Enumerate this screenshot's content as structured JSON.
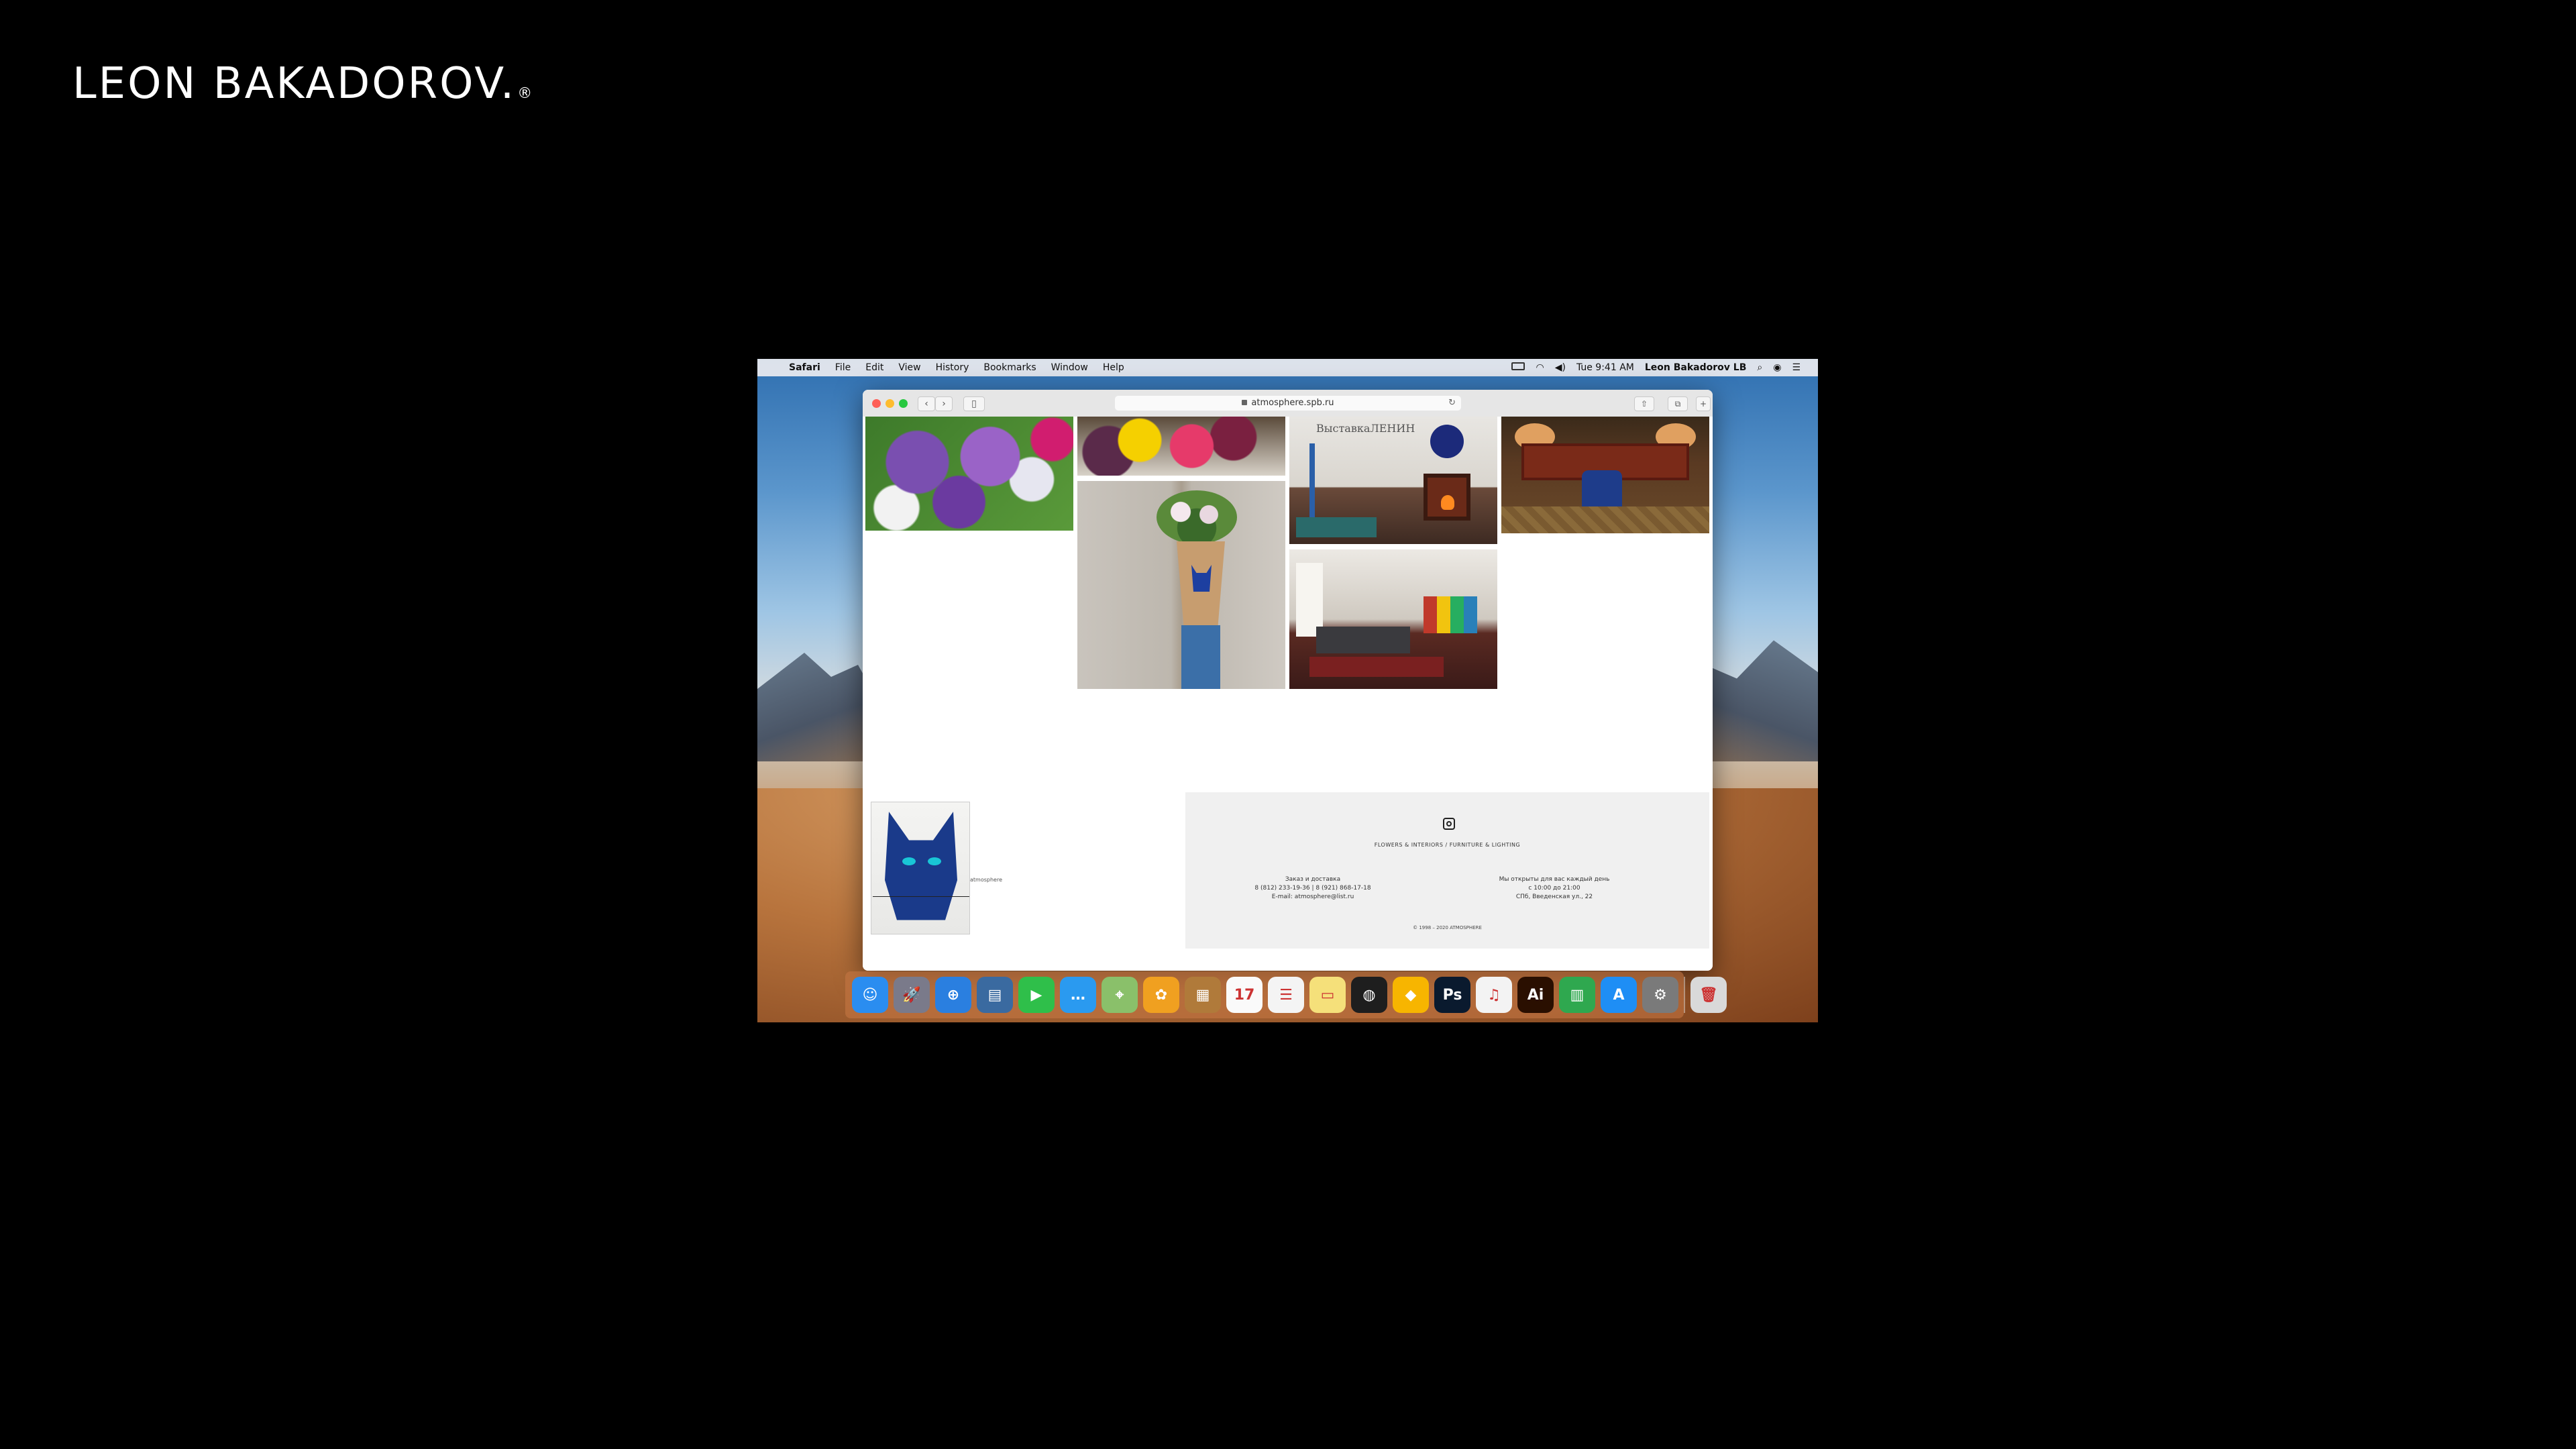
{
  "brand": {
    "name": "LEON BAKADOROV.",
    "mark": "®"
  },
  "menubar": {
    "app": "Safari",
    "items": [
      "File",
      "Edit",
      "View",
      "History",
      "Bookmarks",
      "Window",
      "Help"
    ],
    "clock": "Tue 9:41 AM",
    "user": "Leon Bakadorov LB"
  },
  "browser": {
    "url": "atmosphere.spb.ru",
    "nav_back": "‹",
    "nav_forward": "›"
  },
  "page": {
    "room_text": "ВыставкаЛЕНИН",
    "cat_caption": "atmosphere",
    "footer": {
      "tagline": "FLOWERS & INTERIORS / FURNITURE & LIGHTING",
      "col_left": [
        "Заказ и доставка",
        "8 (812) 233-19-36 | 8 (921) 868-17-18",
        "E-mail: atmosphere@list.ru"
      ],
      "col_right": [
        "Мы открыты для вас каждый день",
        "с 10:00 до 21:00",
        "СПб, Введенская ул., 22"
      ],
      "copyright": "© 1998 – 2020 ATMOSPHERE"
    }
  },
  "dock": {
    "icons": [
      {
        "name": "finder-icon",
        "color": "#2a8df0",
        "glyph": "☺"
      },
      {
        "name": "launchpad-icon",
        "color": "#7a7a8a",
        "glyph": "🚀"
      },
      {
        "name": "safari-icon",
        "color": "#2a7fe0",
        "glyph": "⊕"
      },
      {
        "name": "preview-icon",
        "color": "#3a6aa0",
        "glyph": "▤"
      },
      {
        "name": "facetime-icon",
        "color": "#2fbf4a",
        "glyph": "▶"
      },
      {
        "name": "messages-icon",
        "color": "#2a9af0",
        "glyph": "…"
      },
      {
        "name": "maps-icon",
        "color": "#8ac06a",
        "glyph": "⌖"
      },
      {
        "name": "photos-icon",
        "color": "#f0a020",
        "glyph": "✿"
      },
      {
        "name": "notes-brown-icon",
        "color": "#b07a3a",
        "glyph": "▦"
      },
      {
        "name": "calendar-icon",
        "color": "#fafafa",
        "glyph": "17"
      },
      {
        "name": "reminders-icon",
        "color": "#f4f4f4",
        "glyph": "☰"
      },
      {
        "name": "notes-icon",
        "color": "#f5e07a",
        "glyph": "▭"
      },
      {
        "name": "figma-icon",
        "color": "#1e1e1e",
        "glyph": "◍"
      },
      {
        "name": "sketch-icon",
        "color": "#f7b500",
        "glyph": "◆"
      },
      {
        "name": "photoshop-icon",
        "color": "#0a1a2e",
        "glyph": "Ps"
      },
      {
        "name": "itunes-icon",
        "color": "#f3f3f3",
        "glyph": "♫"
      },
      {
        "name": "illustrator-icon",
        "color": "#2a0f00",
        "glyph": "Ai"
      },
      {
        "name": "numbers-icon",
        "color": "#2fa84f",
        "glyph": "▥"
      },
      {
        "name": "appstore-icon",
        "color": "#1e8ef5",
        "glyph": "A"
      },
      {
        "name": "system-preferences-icon",
        "color": "#7a7a7a",
        "glyph": "⚙"
      },
      {
        "name": "trash-icon",
        "color": "#d9d9d9",
        "glyph": "🗑"
      }
    ]
  }
}
